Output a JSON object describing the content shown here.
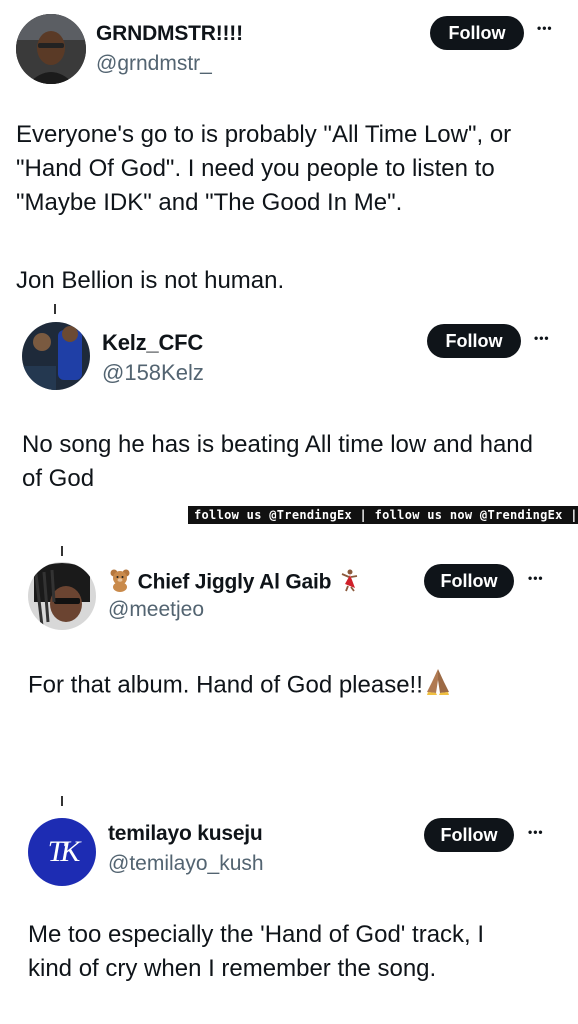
{
  "tweets": [
    {
      "name": "GRNDMSTR!!!!",
      "handle": "@grndmstr_",
      "follow_label": "Follow",
      "more_label": "•••",
      "text": "Everyone's go to is probably \"All Time Low\", or \"Hand Of God\". I need you people to listen to \"Maybe IDK\" and \"The Good In Me\".",
      "text2": "Jon Bellion is not human."
    },
    {
      "name": "Kelz_CFC",
      "handle": "@158Kelz",
      "follow_label": "Follow",
      "more_label": "•••",
      "text": "No song he has is beating All time low and hand of God"
    },
    {
      "name": "Chief Jiggly Al Gaib",
      "handle": "@meetjeo",
      "follow_label": "Follow",
      "more_label": "•••",
      "text": "For that album. Hand of God please!!"
    },
    {
      "name": "temilayo kuseju",
      "handle": "@temilayo_kush",
      "follow_label": "Follow",
      "more_label": "•••",
      "avatar_initials": "TK",
      "text": "Me too especially the 'Hand of God' track, I kind of cry when I remember the song."
    }
  ],
  "banner": {
    "text": "follow us @TrendingEx | follow us now @TrendingEx |"
  },
  "colors": {
    "text": "#0f1419",
    "handle": "#536471",
    "button": "#0f1419",
    "tk_avatar": "#1d2cb3"
  }
}
